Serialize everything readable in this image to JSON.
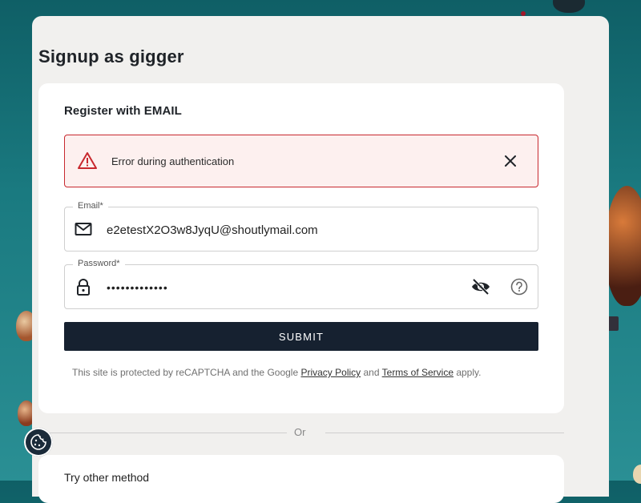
{
  "page": {
    "title": "Signup as gigger"
  },
  "card": {
    "subtitle": "Register with EMAIL"
  },
  "alert": {
    "message": "Error during authentication",
    "icon": "warning-triangle-icon",
    "color": "#c8282e"
  },
  "email": {
    "label": "Email*",
    "value": "e2etestX2O3w8JyqU@shoutlymail.com",
    "icon": "mail-icon"
  },
  "password": {
    "label": "Password*",
    "value": "•••••••••••••",
    "icon": "lock-icon"
  },
  "submit": {
    "label": "SUBMIT",
    "color": "#162130"
  },
  "recaptcha": {
    "prefix": "This site is protected by reCAPTCHA and the Google ",
    "privacy_link": "Privacy Policy",
    "and": " and ",
    "terms_link": "Terms of Service",
    "suffix": " apply."
  },
  "divider": {
    "text": "Or"
  },
  "other": {
    "title": "Try other method"
  }
}
